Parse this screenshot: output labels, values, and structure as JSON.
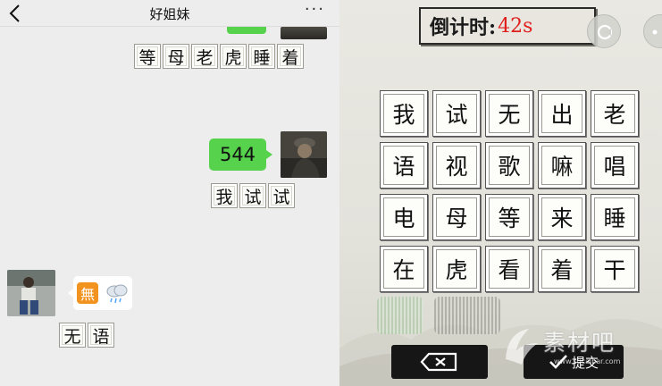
{
  "chat": {
    "title": "好姐妹",
    "more_label": "···",
    "messages": [
      {
        "side": "right",
        "chars": [
          "等",
          "母",
          "老",
          "虎",
          "睡",
          "着"
        ]
      },
      {
        "side": "right",
        "bubble": "544",
        "chars": [
          "我",
          "试",
          "试"
        ]
      },
      {
        "side": "left",
        "emoji": [
          "無",
          "rain-cloud-icon"
        ],
        "chars": [
          "无",
          "语"
        ]
      }
    ]
  },
  "game": {
    "timer_label": "倒计时:",
    "timer_value": "42s",
    "grid": [
      [
        "我",
        "试",
        "无",
        "出",
        "老"
      ],
      [
        "语",
        "视",
        "歌",
        "嘛",
        "唱"
      ],
      [
        "电",
        "母",
        "等",
        "来",
        "睡"
      ],
      [
        "在",
        "虎",
        "看",
        "着",
        "干"
      ]
    ],
    "submit_label": "提交",
    "watermark": {
      "text": "素材吧",
      "url": "www.sucaibar.com"
    }
  },
  "colors": {
    "bubble_green": "#57d24d",
    "timer_red": "#e01e1e",
    "emoji_orange": "#f3931f"
  }
}
